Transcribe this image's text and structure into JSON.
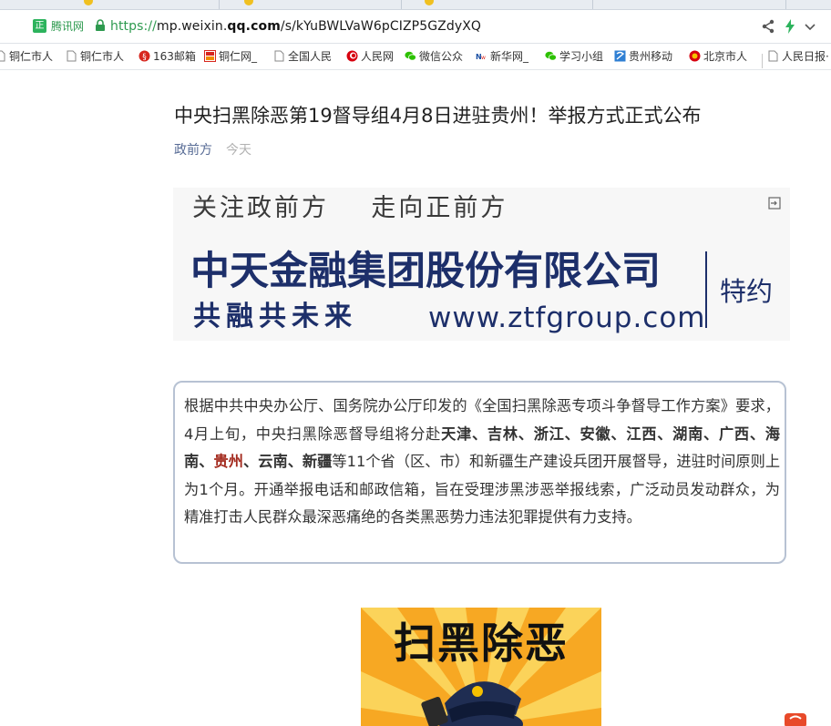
{
  "browser": {
    "site_badge": "正",
    "site_name": "腾讯网",
    "url_protocol": "https://",
    "url_prefix": "mp.weixin.",
    "url_domain": "qq.com",
    "url_path": "/s/kYuBWLVaW6pCIZP5GZdyXQ",
    "bookmarks": [
      {
        "label": "铜仁市人",
        "icon": "page-icon"
      },
      {
        "label": "铜仁市人",
        "icon": "page-icon"
      },
      {
        "label": "163邮箱",
        "icon": "163-mail-icon"
      },
      {
        "label": "铜仁网_",
        "icon": "tongren-net-icon"
      },
      {
        "label": "全国人民",
        "icon": "page-icon"
      },
      {
        "label": "人民网",
        "icon": "people-net-icon"
      },
      {
        "label": "微信公众",
        "icon": "wechat-icon"
      },
      {
        "label": "新华网_",
        "icon": "xinhua-icon"
      },
      {
        "label": "学习小组",
        "icon": "wechat-icon"
      },
      {
        "label": "贵州移动",
        "icon": "guizhou-mobile-icon"
      },
      {
        "label": "北京市人",
        "icon": "emblem-icon"
      },
      {
        "label": "人民日报·",
        "icon": "page-icon"
      }
    ]
  },
  "article": {
    "title": "中央扫黑除恶第19督导组4月8日进驻贵州！举报方式正式公布",
    "author": "政前方",
    "date": "今天"
  },
  "ad": {
    "slogan": "关注政前方    走向正前方",
    "company": "中天金融集团股份有限公司",
    "motto": "共融共未来",
    "url": "www.ztfgroup.com",
    "sponsor": "特约",
    "brand_color": "#1d2f6a"
  },
  "intro": {
    "p1": "根据中共中央办公厅、国务院办公厅印发的《全国扫黑除恶专项斗争督导工作方案》要求，4月上旬，中央扫黑除恶督导组将分赴",
    "regions_a": "天津、吉林、浙江、安徽、江西、湖南、广西、海南、",
    "regions_highlight": "贵州",
    "regions_b": "、云南、新疆",
    "p2": "等11个省（区、市）和新疆生产建设兵团开展督导，进驻时间原则上为1个月。开通举报电话和邮政信箱，旨在受理涉黑涉恶举报线索，广泛动员发动群众，为精准打击人民群众最深恶痛绝的各类黑恶势力违法犯罪提供有力支持。",
    "highlight_color": "#a32a1e"
  },
  "hero": {
    "text": "扫黑除恶"
  }
}
